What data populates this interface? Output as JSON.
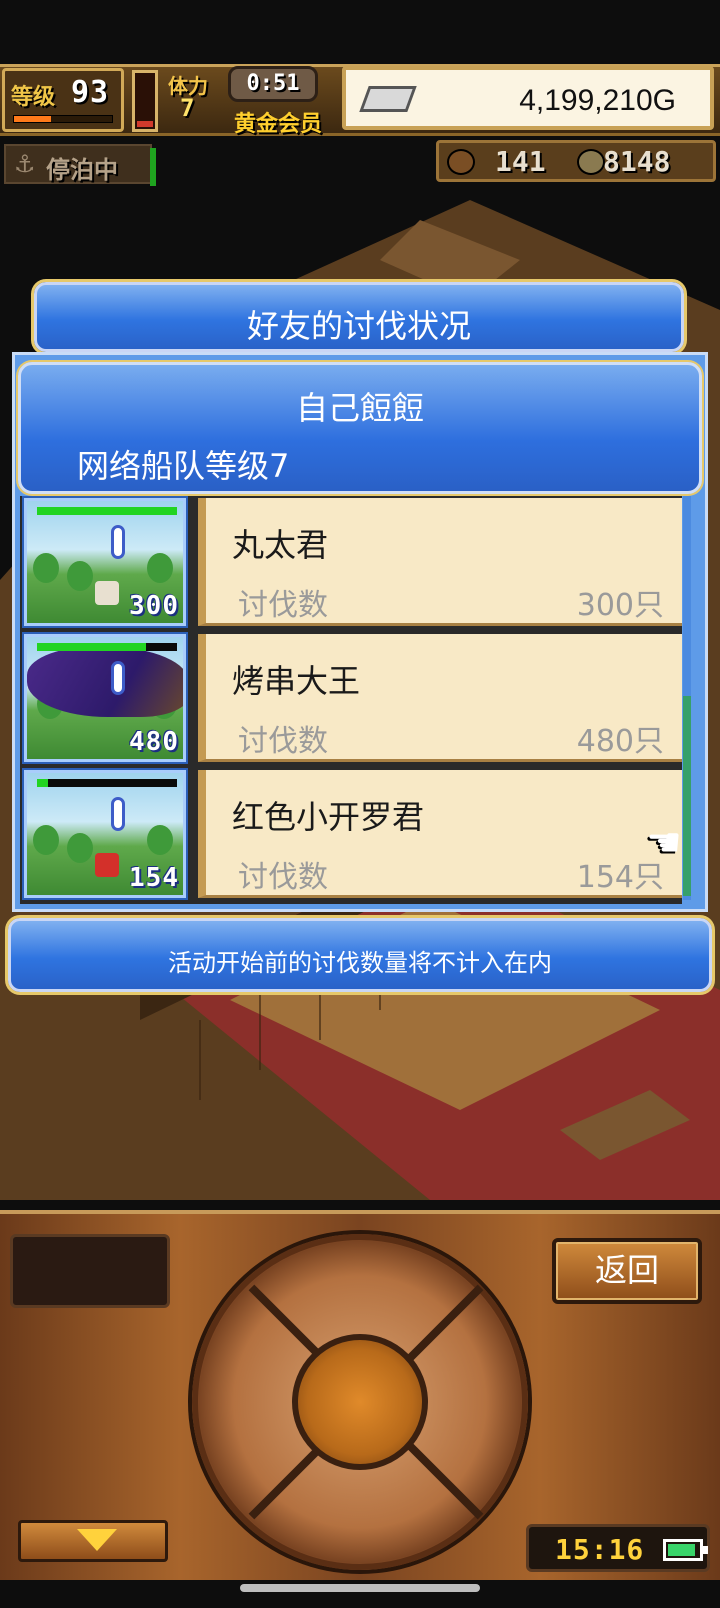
{
  "hud": {
    "level_label": "等级",
    "level": "93",
    "xp_progress": 0.38,
    "stamina_label": "体力",
    "stamina": "7",
    "stamina_fill": 0.12,
    "timer": "0:51",
    "membership": "黄金会员",
    "money": "4,199,210G",
    "status": "停泊中",
    "resource_1": "141",
    "resource_2": "8148"
  },
  "dialog": {
    "title": "好友的讨伐状况",
    "self_name": "自己餖餖",
    "fleet_level": "网络船队等级7",
    "friends": [
      {
        "name": "丸太君",
        "count_label": "讨伐数",
        "count_text": "300只",
        "badge": "300",
        "hp": 1.0
      },
      {
        "name": "烤串大王",
        "count_label": "讨伐数",
        "count_text": "480只",
        "badge": "480",
        "hp": 0.78
      },
      {
        "name": "红色小开罗君",
        "count_label": "讨伐数",
        "count_text": "154只",
        "badge": "154",
        "hp": 0.08
      }
    ],
    "note": "活动开始前的讨伐数量将不计入在内"
  },
  "controls": {
    "back_label": "返回",
    "clock": "15:16",
    "battery_level": 0.9
  },
  "colors": {
    "panel_blue": "#2f74e0",
    "card_cream": "#f8e9c6",
    "gold": "#ffcf2e",
    "wood": "#a8652c"
  }
}
